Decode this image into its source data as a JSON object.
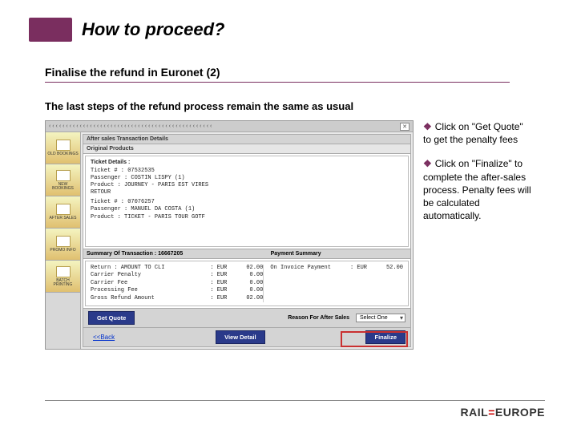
{
  "header": {
    "title": "How to proceed?"
  },
  "subtitle": "Finalise the refund in Euronet (2)",
  "body_text": "The last steps of the refund process remain the same as usual",
  "notes": {
    "bullet": "❖",
    "p1": "Click on \"Get Quote\" to get the penalty fees",
    "p2": "Click on \"Finalize\" to complete the after-sales process. Penalty fees will be calculated automatically."
  },
  "app": {
    "titlebar_dots": "‹ ‹ ‹ ‹ ‹ ‹ ‹ ‹ ‹ ‹ ‹ ‹ ‹ ‹ ‹ ‹ ‹ ‹ ‹ ‹ ‹ ‹ ‹ ‹ ‹ ‹ ‹ ‹ ‹ ‹ ‹ ‹ ‹ ‹ ‹ ‹ ‹ ‹ ‹ ‹ ‹ ‹ ‹ ‹ ‹ ‹ ‹ ‹",
    "close": "✕",
    "sidebar": [
      "OLD\nBOOKINGS",
      "NEW\nBOOKINGS",
      "AFTER\nSALES",
      "PROMO\nINFO",
      "BATCH\nPRINTING"
    ],
    "section_title": "After sales Transaction Details",
    "original_products": "Original Products",
    "ticket_details": "Ticket Details :",
    "ticket1": {
      "l1": "Ticket # : 07532535",
      "l2": "Passenger : COSTIN LISPY (1)",
      "l3": "Product  : JOURNEY - PARIS EST VIRES",
      "l4": "           RETOUR"
    },
    "ticket2": {
      "l1": "Ticket # : 07076257",
      "l2": "Passenger : MANUEL DA COSTA (1)",
      "l3": "Product  : TICKET - PARIS TOUR GOTF"
    },
    "summary_label": "Summary Of Transaction  : 16667205",
    "payment_label": "Payment Summary",
    "summary": [
      {
        "k": "Return   : AMOUNT TO CLI",
        "c": ": EUR",
        "v": "02.00"
      },
      {
        "k": "Carrier Penalty",
        "c": ": EUR",
        "v": "0.00"
      },
      {
        "k": "Carrier Fee",
        "c": ": EUR",
        "v": "0.00"
      },
      {
        "k": "Processing Fee",
        "c": ": EUR",
        "v": "0.00"
      },
      {
        "k": "Gross Refund Amount",
        "c": ": EUR",
        "v": "02.00"
      }
    ],
    "payment": {
      "k": "On Invoice Payment",
      "c": ": EUR",
      "v": "52.00"
    },
    "buttons": {
      "get_quote": "Get Quote",
      "reason_label": "Reason For After Sales",
      "reason_value": "Select One",
      "back": "<<Back",
      "view_detail": "View Detail",
      "finalize": "Finalize"
    }
  },
  "logo": {
    "rail": "RAIL",
    "eq": "=",
    "europe": "EUROPE"
  }
}
